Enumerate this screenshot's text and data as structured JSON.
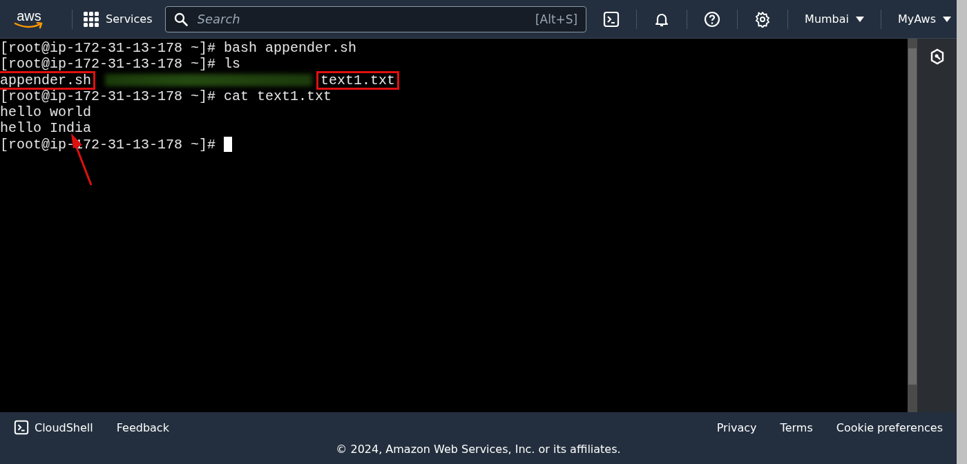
{
  "top_nav": {
    "logo": "aws",
    "services": "Services",
    "search": {
      "placeholder": "Search",
      "shortcut": "[Alt+S]"
    },
    "region": "Mumbai",
    "account": "MyAws"
  },
  "terminal": {
    "lines": [
      {
        "kind": "prompt",
        "prompt": "[root@ip-172-31-13-178 ~]#",
        "command": "bash appender.sh",
        "cursor": false
      },
      {
        "kind": "prompt",
        "prompt": "[root@ip-172-31-13-178 ~]#",
        "command": "ls",
        "cursor": false
      },
      {
        "kind": "files",
        "files": [
          {
            "kind": "file",
            "name": "appender.sh",
            "highlighted": true
          },
          {
            "kind": "redacted"
          },
          {
            "kind": "file",
            "name": "text1.txt",
            "highlighted": true
          }
        ]
      },
      {
        "kind": "prompt",
        "prompt": "[root@ip-172-31-13-178 ~]#",
        "command": "cat text1.txt",
        "cursor": false
      },
      {
        "kind": "output",
        "text": "hello world"
      },
      {
        "kind": "output",
        "text": "hello India"
      },
      {
        "kind": "prompt",
        "prompt": "[root@ip-172-31-13-178 ~]#",
        "cursor": true
      }
    ]
  },
  "footer": {
    "cloudshell": "CloudShell",
    "feedback": "Feedback",
    "links": [
      "Privacy",
      "Terms",
      "Cookie preferences"
    ],
    "copyright": "© 2024, Amazon Web Services, Inc. or its affiliates."
  }
}
